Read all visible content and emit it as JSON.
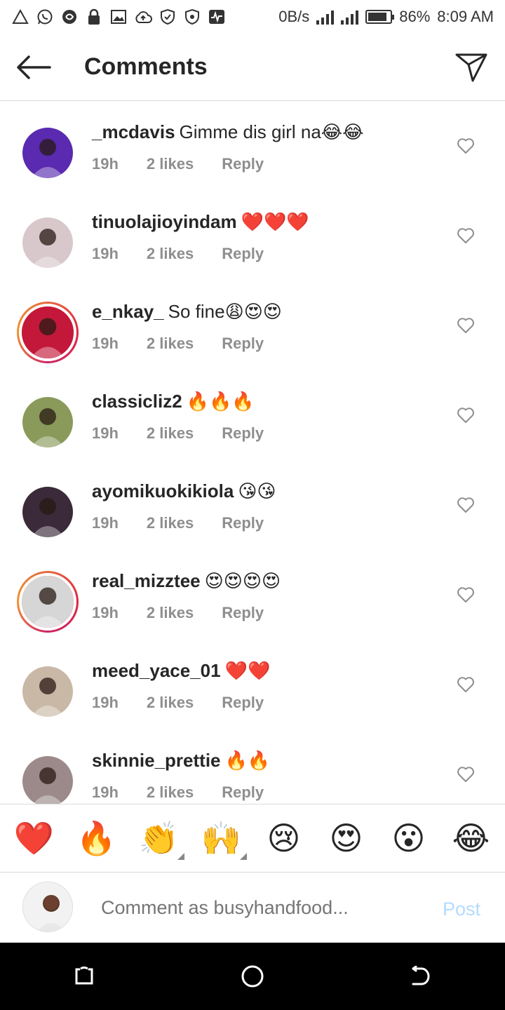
{
  "status_bar": {
    "net_speed": "0B/s",
    "battery_percent": "86%",
    "battery_level": 0.86,
    "time": "8:09 AM",
    "icons": [
      "alert-triangle-icon",
      "whatsapp-icon",
      "swirl-icon",
      "lock-icon",
      "image-icon",
      "cloud-upload-icon",
      "shield-icon",
      "shield-icon",
      "activity-icon"
    ]
  },
  "header": {
    "title": "Comments"
  },
  "comments": [
    {
      "user": "_mcdavis",
      "text": "Gimme dis girl na😂😂",
      "time": "19h",
      "likes": "2 likes",
      "reply": "Reply",
      "story": false,
      "avatar_color": "#5a2ab0"
    },
    {
      "user": "tinuolajioyindam",
      "text": "❤️❤️❤️",
      "time": "19h",
      "likes": "2 likes",
      "reply": "Reply",
      "story": false,
      "avatar_color": "#d8c8cc"
    },
    {
      "user": "e_nkay_",
      "text": "So fine😩😍😍",
      "time": "19h",
      "likes": "2 likes",
      "reply": "Reply",
      "story": true,
      "avatar_color": "#c4183a"
    },
    {
      "user": "classicliz2",
      "text": "🔥🔥🔥",
      "time": "19h",
      "likes": "2 likes",
      "reply": "Reply",
      "story": false,
      "avatar_color": "#8a9a5a"
    },
    {
      "user": "ayomikuokikiola",
      "text": "😘😘",
      "time": "19h",
      "likes": "2 likes",
      "reply": "Reply",
      "story": false,
      "avatar_color": "#3a2a3a"
    },
    {
      "user": "real_mizztee",
      "text": "😍😍😍😍",
      "time": "19h",
      "likes": "2 likes",
      "reply": "Reply",
      "story": true,
      "avatar_color": "#d6d6d6"
    },
    {
      "user": "meed_yace_01",
      "text": "❤️❤️",
      "time": "19h",
      "likes": "2 likes",
      "reply": "Reply",
      "story": false,
      "avatar_color": "#c9b8a6"
    },
    {
      "user": "skinnie_prettie",
      "text": "🔥🔥",
      "time": "19h",
      "likes": "2 likes",
      "reply": "Reply",
      "story": false,
      "avatar_color": "#9c8a8a"
    }
  ],
  "emoji_bar": [
    {
      "emoji": "❤️",
      "name": "red-heart-emoji",
      "more": false
    },
    {
      "emoji": "🔥",
      "name": "fire-emoji",
      "more": false
    },
    {
      "emoji": "👏",
      "name": "clapping-emoji",
      "more": true
    },
    {
      "emoji": "🙌",
      "name": "raising-hands-emoji",
      "more": true
    },
    {
      "emoji": "😢",
      "name": "crying-emoji",
      "more": false
    },
    {
      "emoji": "😍",
      "name": "heart-eyes-emoji",
      "more": false
    },
    {
      "emoji": "😮",
      "name": "surprised-emoji",
      "more": false
    },
    {
      "emoji": "😂",
      "name": "laughing-emoji",
      "more": false
    }
  ],
  "composer": {
    "placeholder": "Comment as busyhandfood...",
    "post_label": "Post",
    "post_color": "#b3dbff"
  },
  "colors": {
    "text": "#262626",
    "meta": "#8e8e8e",
    "divider": "#dbdbdb"
  }
}
